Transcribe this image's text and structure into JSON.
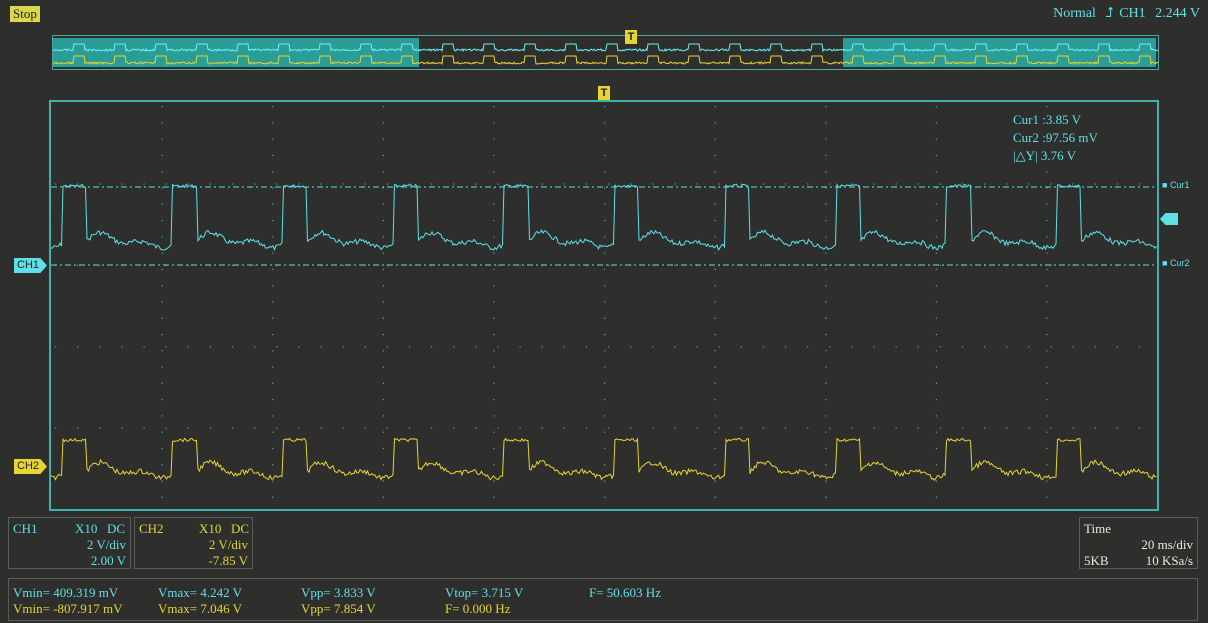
{
  "status": "Stop",
  "trigger": {
    "mode": "Normal",
    "source": "CH1",
    "level": "2.244 V",
    "marker": "T"
  },
  "channels": {
    "ch1_label": "CH1",
    "ch2_label": "CH2"
  },
  "cursors": {
    "cur1_label": "Cur1",
    "cur1_value": "3.85 V",
    "cur2_label": "Cur2",
    "cur2_value": "97.56 mV",
    "delta_label": "|△Y|",
    "delta_value": "3.76 V",
    "tag1": "Cur1",
    "tag2": "Cur2"
  },
  "ch1": {
    "name": "CH1",
    "probe": "X10",
    "coupling": "DC",
    "scale": "2 V/div",
    "offset": "2.00 V"
  },
  "ch2": {
    "name": "CH2",
    "probe": "X10",
    "coupling": "DC",
    "scale": "2 V/div",
    "offset": "-7.85 V"
  },
  "time": {
    "title": "Time",
    "scale": "20 ms/div",
    "memory": "5KB",
    "rate": "10 KSa/s"
  },
  "measurements": {
    "ch1": {
      "vmin": "Vmin= 409.319 mV",
      "vmax": "Vmax= 4.242 V",
      "vpp": "Vpp= 3.833 V",
      "vtop": "Vtop= 3.715 V",
      "freq": "F= 50.603 Hz"
    },
    "ch2": {
      "vmin": "Vmin= -807.917 mV",
      "vmax": "Vmax= 7.046 V",
      "vpp": "Vpp= 7.854 V",
      "freq": "F= 0.000 Hz"
    }
  },
  "colors": {
    "ch1": "#5fe0e8",
    "ch2": "#e5d432",
    "grid": "#3fb0ae",
    "background": "#2e2f2d"
  }
}
